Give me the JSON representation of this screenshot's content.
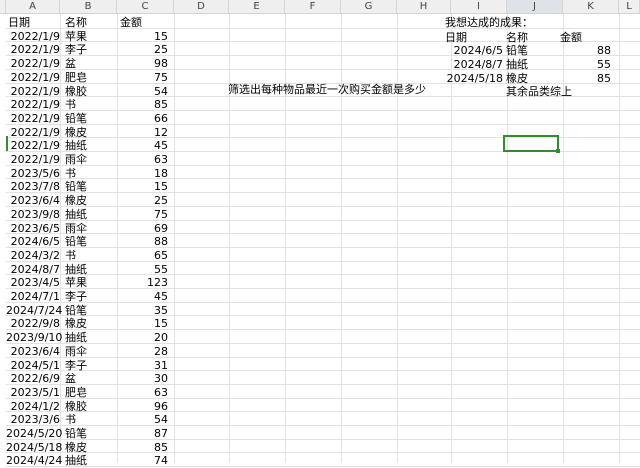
{
  "columns": [
    "A",
    "B",
    "C",
    "D",
    "E",
    "F",
    "G",
    "H",
    "I",
    "J",
    "K",
    "L"
  ],
  "selected_column": "J",
  "left_table": {
    "headers": [
      "日期",
      "名称",
      "金额"
    ],
    "rows": [
      [
        "2022/1/9",
        "苹果",
        "15"
      ],
      [
        "2022/1/9",
        "李子",
        "25"
      ],
      [
        "2022/1/9",
        "盆",
        "98"
      ],
      [
        "2022/1/9",
        "肥皂",
        "75"
      ],
      [
        "2022/1/9",
        "橡胶",
        "54"
      ],
      [
        "2022/1/9",
        "书",
        "85"
      ],
      [
        "2022/1/9",
        "铅笔",
        "66"
      ],
      [
        "2022/1/9",
        "橡皮",
        "12"
      ],
      [
        "2022/1/9",
        "抽纸",
        "45"
      ],
      [
        "2022/1/9",
        "雨伞",
        "63"
      ],
      [
        "2023/5/6",
        "书",
        "18"
      ],
      [
        "2023/7/8",
        "铅笔",
        "15"
      ],
      [
        "2023/6/4",
        "橡皮",
        "25"
      ],
      [
        "2023/9/8",
        "抽纸",
        "75"
      ],
      [
        "2023/6/5",
        "雨伞",
        "69"
      ],
      [
        "2024/6/5",
        "铅笔",
        "88"
      ],
      [
        "2024/3/2",
        "书",
        "65"
      ],
      [
        "2024/8/7",
        "抽纸",
        "55"
      ],
      [
        "2023/4/5",
        "苹果",
        "123"
      ],
      [
        "2024/7/1",
        "李子",
        "45"
      ],
      [
        "2024/7/24",
        "铅笔",
        "35"
      ],
      [
        "2022/9/8",
        "橡皮",
        "15"
      ],
      [
        "2023/9/10",
        "抽纸",
        "20"
      ],
      [
        "2023/6/4",
        "雨伞",
        "28"
      ],
      [
        "2024/5/1",
        "李子",
        "31"
      ],
      [
        "2022/6/9",
        "盆",
        "30"
      ],
      [
        "2023/5/1",
        "肥皂",
        "63"
      ],
      [
        "2024/1/2",
        "橡胶",
        "96"
      ],
      [
        "2023/3/6",
        "书",
        "54"
      ],
      [
        "2024/5/20",
        "铅笔",
        "87"
      ],
      [
        "2024/5/18",
        "橡皮",
        "85"
      ],
      [
        "2024/4/24",
        "抽纸",
        "74"
      ]
    ]
  },
  "instruction_note": "筛选出每种物品最近一次购买金额是多少",
  "result": {
    "title": "我想达成的成果：",
    "headers": [
      "日期",
      "名称",
      "金额"
    ],
    "rows": [
      [
        "2024/6/5",
        "铅笔",
        "88"
      ],
      [
        "2024/8/7",
        "抽纸",
        "55"
      ],
      [
        "2024/5/18",
        "橡皮",
        "85"
      ]
    ],
    "note": "其余品类综上"
  }
}
